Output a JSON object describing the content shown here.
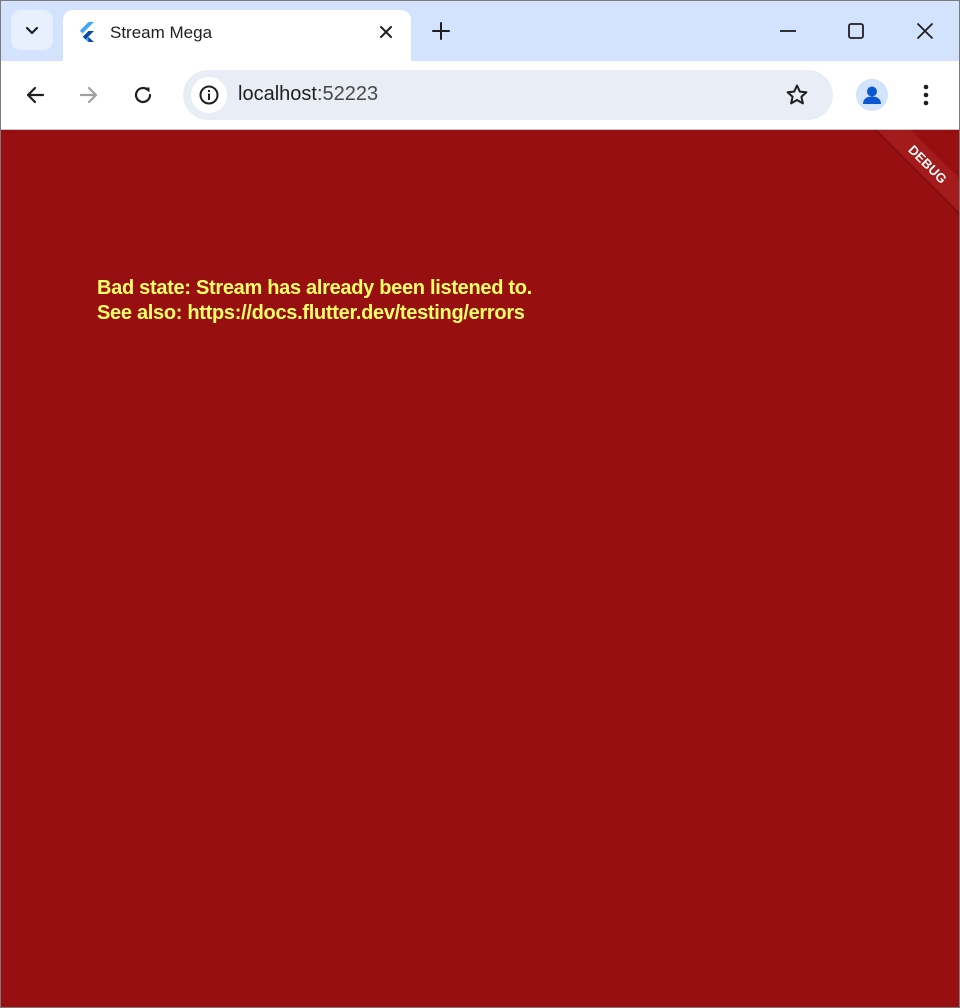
{
  "browser": {
    "tab": {
      "title": "Stream Mega",
      "favicon": "flutter-logo"
    },
    "address_bar": {
      "host": "localhost",
      "port": ":52223"
    },
    "icons": {
      "tab_search": "chevron-down-icon",
      "tab_close": "close-icon",
      "new_tab": "plus-icon",
      "minimize": "minimize-icon",
      "maximize": "maximize-icon",
      "close_window": "close-icon",
      "back": "arrow-left-icon",
      "forward": "arrow-right-icon",
      "reload": "reload-icon",
      "site_info": "info-icon",
      "bookmark": "star-icon",
      "profile": "person-icon",
      "menu": "more-vertical-icon"
    },
    "colors": {
      "tabstrip": "#d3e3fd",
      "omnibox": "#e9eef6"
    }
  },
  "app": {
    "error": {
      "line1": "Bad state: Stream has already been listened to.",
      "line2": "See also: https://docs.flutter.dev/testing/errors"
    },
    "debug_banner": "DEBUG",
    "colors": {
      "background": "#970f10",
      "error_text": "#ffff66",
      "banner": "#a41b1b"
    }
  }
}
